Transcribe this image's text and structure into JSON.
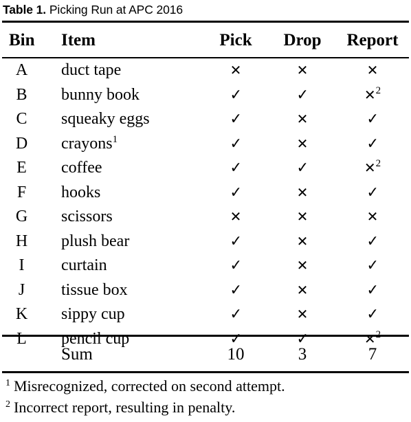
{
  "caption": {
    "label": "Table 1.",
    "text": "Picking Run at APC 2016"
  },
  "table": {
    "columns": [
      "Bin",
      "Item",
      "Pick",
      "Drop",
      "Report"
    ],
    "rows": [
      {
        "bin": "A",
        "item": "duct tape",
        "item_sup": "",
        "pick": "✕",
        "pick_sup": "",
        "drop": "✕",
        "drop_sup": "",
        "report": "✕",
        "report_sup": ""
      },
      {
        "bin": "B",
        "item": "bunny book",
        "item_sup": "",
        "pick": "✓",
        "pick_sup": "",
        "drop": "✓",
        "drop_sup": "",
        "report": "✕",
        "report_sup": "2"
      },
      {
        "bin": "C",
        "item": "squeaky eggs",
        "item_sup": "",
        "pick": "✓",
        "pick_sup": "",
        "drop": "✕",
        "drop_sup": "",
        "report": "✓",
        "report_sup": ""
      },
      {
        "bin": "D",
        "item": "crayons",
        "item_sup": "1",
        "pick": "✓",
        "pick_sup": "",
        "drop": "✕",
        "drop_sup": "",
        "report": "✓",
        "report_sup": ""
      },
      {
        "bin": "E",
        "item": "coffee",
        "item_sup": "",
        "pick": "✓",
        "pick_sup": "",
        "drop": "✓",
        "drop_sup": "",
        "report": "✕",
        "report_sup": "2"
      },
      {
        "bin": "F",
        "item": "hooks",
        "item_sup": "",
        "pick": "✓",
        "pick_sup": "",
        "drop": "✕",
        "drop_sup": "",
        "report": "✓",
        "report_sup": ""
      },
      {
        "bin": "G",
        "item": "scissors",
        "item_sup": "",
        "pick": "✕",
        "pick_sup": "",
        "drop": "✕",
        "drop_sup": "",
        "report": "✕",
        "report_sup": ""
      },
      {
        "bin": "H",
        "item": "plush bear",
        "item_sup": "",
        "pick": "✓",
        "pick_sup": "",
        "drop": "✕",
        "drop_sup": "",
        "report": "✓",
        "report_sup": ""
      },
      {
        "bin": "I",
        "item": "curtain",
        "item_sup": "",
        "pick": "✓",
        "pick_sup": "",
        "drop": "✕",
        "drop_sup": "",
        "report": "✓",
        "report_sup": ""
      },
      {
        "bin": "J",
        "item": "tissue box",
        "item_sup": "",
        "pick": "✓",
        "pick_sup": "",
        "drop": "✕",
        "drop_sup": "",
        "report": "✓",
        "report_sup": ""
      },
      {
        "bin": "K",
        "item": "sippy cup",
        "item_sup": "",
        "pick": "✓",
        "pick_sup": "",
        "drop": "✕",
        "drop_sup": "",
        "report": "✓",
        "report_sup": ""
      },
      {
        "bin": "L",
        "item": "pencil cup",
        "item_sup": "",
        "pick": "✓",
        "pick_sup": "",
        "drop": "✓",
        "drop_sup": "",
        "report": "✕",
        "report_sup": "2"
      }
    ],
    "summary": {
      "label": "Sum",
      "pick": "10",
      "drop": "3",
      "report": "7"
    }
  },
  "footnotes": [
    {
      "num": "1",
      "text": "Misrecognized, corrected on second attempt."
    },
    {
      "num": "2",
      "text": "Incorrect report, resulting in penalty."
    }
  ],
  "colors": {
    "text": "#000000",
    "rule": "#000000",
    "background": "#ffffff"
  }
}
